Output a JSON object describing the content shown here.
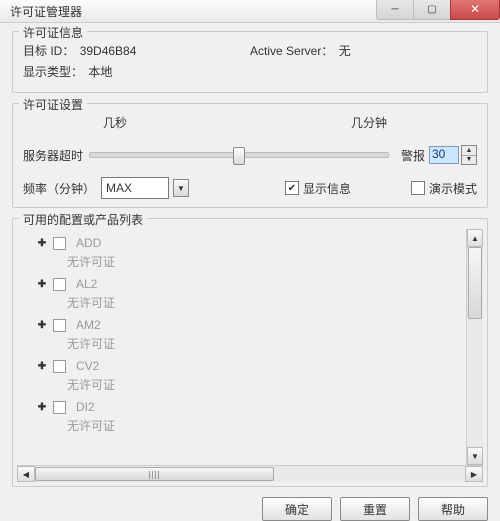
{
  "window": {
    "title": "许可证管理器"
  },
  "info": {
    "legend": "许可证信息",
    "target_label": "目标 ID：",
    "target_value": "39D46B84",
    "type_label": "显示类型：",
    "type_value": "本地",
    "server_label": "Active Server：",
    "server_value": "无"
  },
  "settings": {
    "legend": "许可证设置",
    "seconds_label": "几秒",
    "minutes_label": "几分钟",
    "timeout_label": "服务器超时",
    "alarm_label": "警报",
    "alarm_value": "30",
    "freq_label": "频率（分钟）",
    "freq_value": "MAX",
    "show_info_label": "显示信息",
    "show_info_checked": true,
    "demo_label": "演示模式",
    "demo_checked": false
  },
  "products": {
    "legend": "可用的配置或产品列表",
    "no_license": "无许可证",
    "items": [
      {
        "code": "ADD"
      },
      {
        "code": "AL2"
      },
      {
        "code": "AM2"
      },
      {
        "code": "CV2"
      },
      {
        "code": "DI2"
      }
    ]
  },
  "buttons": {
    "ok": "确定",
    "reset": "重置",
    "help": "帮助"
  }
}
